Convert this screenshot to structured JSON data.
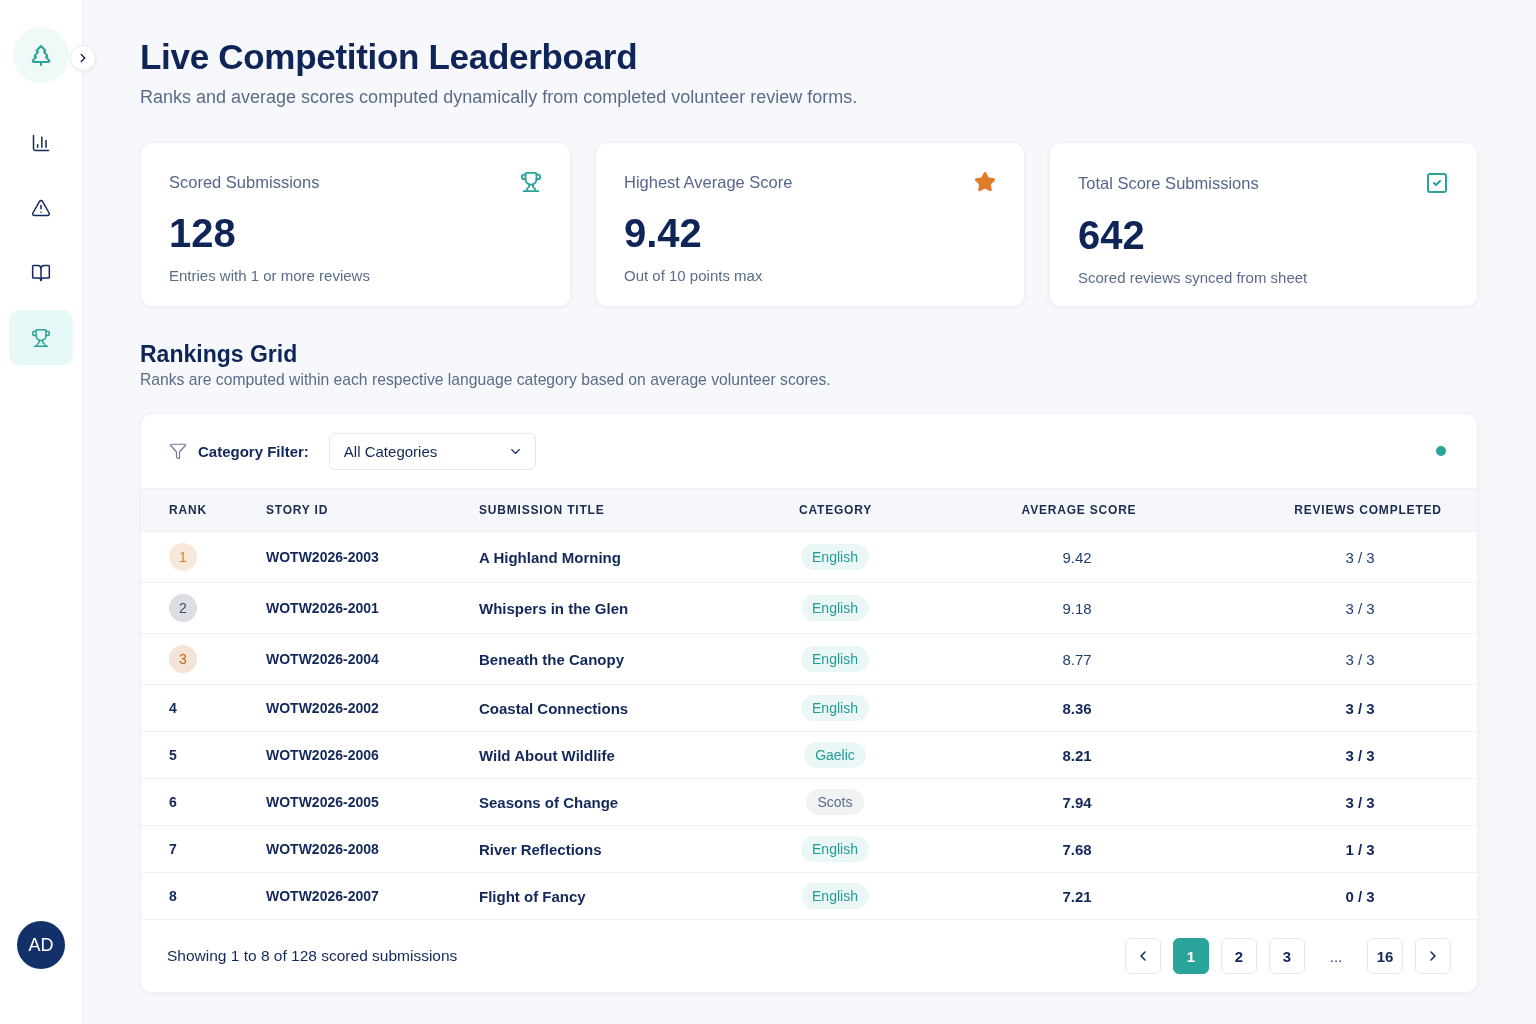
{
  "sidebar": {
    "items": [
      {
        "selected": false
      },
      {
        "selected": false
      },
      {
        "selected": false
      },
      {
        "selected": true
      }
    ],
    "avatar": {
      "initials": "AD"
    }
  },
  "header": {
    "title": "Live Competition Leaderboard",
    "subtitle": "Ranks and average scores computed dynamically from completed volunteer review forms."
  },
  "stats": [
    {
      "label": "Scored Submissions",
      "value": "128",
      "caption": "Entries with 1 or more reviews"
    },
    {
      "label": "Highest Average Score",
      "value": "9.42",
      "caption": "Out of 10 points max"
    },
    {
      "label": "Total Score Submissions",
      "value": "642",
      "caption": "Scored reviews synced from sheet"
    }
  ],
  "rankings": {
    "title": "Rankings Grid",
    "subtitle": "Ranks are computed within each respective language category based on average volunteer scores.",
    "filter": {
      "label": "Category Filter:",
      "value": "All Categories"
    },
    "live": true,
    "table": {
      "columns": [
        "RANK",
        "STORY ID",
        "SUBMISSION TITLE",
        "CATEGORY",
        "AVERAGE SCORE",
        "REVIEWS COMPLETED"
      ],
      "rows": [
        {
          "rank": {
            "kind": "badge",
            "label": "1",
            "color": "#d9822b"
          },
          "story_id": "WOTW2026-2003",
          "title": "A Highland Morning",
          "category": {
            "label": "English",
            "color": "#1f9e96"
          },
          "score": "9.42",
          "reviews": "3 / 3"
        },
        {
          "rank": {
            "kind": "badge",
            "label": "2",
            "color": "#3b4a6b"
          },
          "story_id": "WOTW2026-2001",
          "title": "Whispers in the Glen",
          "category": {
            "label": "English",
            "color": "#1f9e96"
          },
          "score": "9.18",
          "reviews": "3 / 3"
        },
        {
          "rank": {
            "kind": "badge",
            "label": "3",
            "color": "#c2661a"
          },
          "story_id": "WOTW2026-2004",
          "title": "Beneath the Canopy",
          "category": {
            "label": "English",
            "color": "#1f9e96"
          },
          "score": "8.77",
          "reviews": "3 / 3"
        },
        {
          "rank": {
            "kind": "plain",
            "label": "4"
          },
          "story_id": "WOTW2026-2002",
          "title": "Coastal Connections",
          "category": {
            "label": "English",
            "color": "#1f9e96"
          },
          "score": "8.36",
          "reviews": "3 / 3"
        },
        {
          "rank": {
            "kind": "plain",
            "label": "5"
          },
          "story_id": "WOTW2026-2006",
          "title": "Wild About Wildlife",
          "category": {
            "label": "Gaelic",
            "color": "#1f9e96"
          },
          "score": "8.21",
          "reviews": "3 / 3"
        },
        {
          "rank": {
            "kind": "plain",
            "label": "6"
          },
          "story_id": "WOTW2026-2005",
          "title": "Seasons of Change",
          "category": {
            "label": "Scots",
            "color": "#5b6b88"
          },
          "score": "7.94",
          "reviews": "3 / 3"
        },
        {
          "rank": {
            "kind": "plain",
            "label": "7"
          },
          "story_id": "WOTW2026-2008",
          "title": "River Reflections",
          "category": {
            "label": "English",
            "color": "#1f9e96"
          },
          "score": "7.68",
          "reviews": "1 / 3"
        },
        {
          "rank": {
            "kind": "plain",
            "label": "8"
          },
          "story_id": "WOTW2026-2007",
          "title": "Flight of Fancy",
          "category": {
            "label": "English",
            "color": "#1f9e96"
          },
          "score": "7.21",
          "reviews": "0 / 3"
        }
      ]
    },
    "footer": {
      "summary": "Showing 1 to 8 of 128 scored submissions",
      "pages": [
        {
          "kind": "page",
          "label": "1",
          "selected": true
        },
        {
          "kind": "page",
          "label": "2",
          "selected": false
        },
        {
          "kind": "page",
          "label": "3",
          "selected": false
        },
        {
          "kind": "ellipsis",
          "label": "..."
        },
        {
          "kind": "page",
          "label": "16",
          "selected": false
        }
      ]
    }
  }
}
